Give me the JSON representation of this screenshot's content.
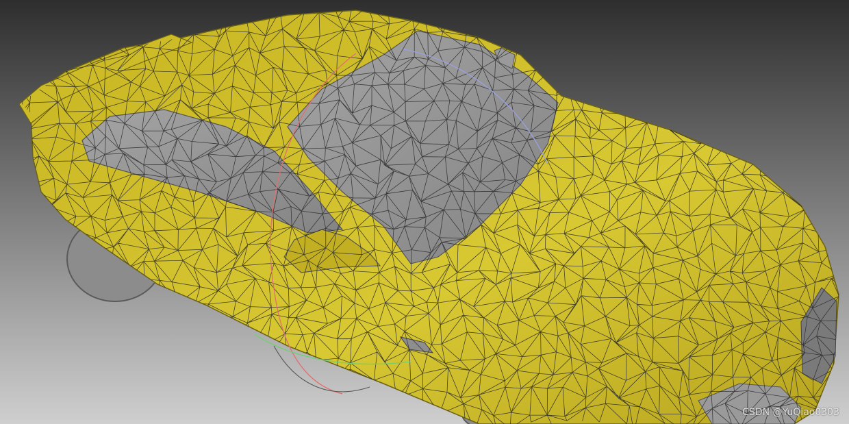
{
  "viewport": {
    "background_top": "#2e2e2e",
    "background_bottom": "#cfcfcf",
    "mesh_wire_color": "#2a2a2a"
  },
  "model": {
    "body_color": "#d2c02a",
    "body_shade": "#a8951c",
    "glass_color": "#9a9a9a",
    "glass_shade": "#6c6c6c",
    "tire_color": "#8a8a8a"
  },
  "gizmo": {
    "x_axis_color": "#e07070",
    "y_axis_color": "#70d070",
    "z_axis_color": "#9aa0e0"
  },
  "watermark": {
    "text": "CSDN @YuQiao0303"
  }
}
